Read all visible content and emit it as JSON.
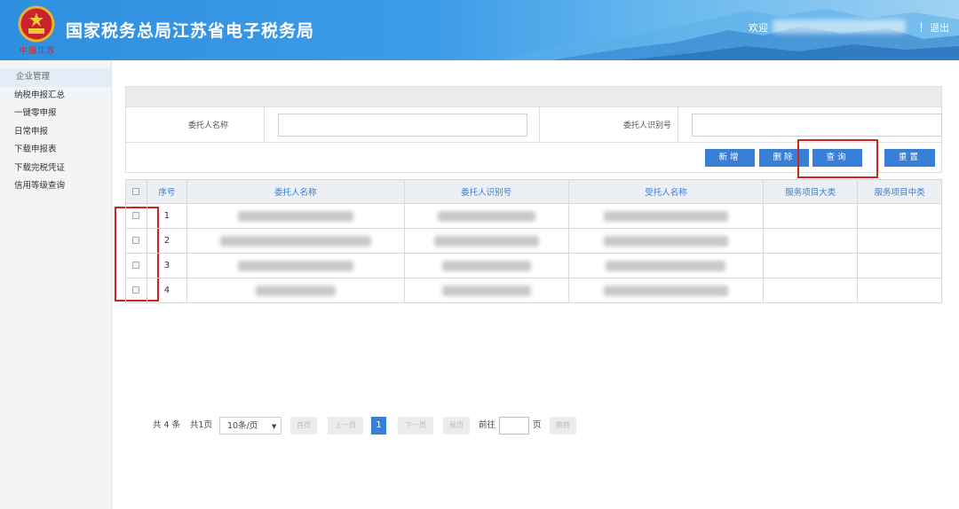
{
  "header": {
    "title": "国家税务总局江苏省电子税务局",
    "sub_logo": "中国江苏",
    "welcome": "欢迎",
    "logout": "退出"
  },
  "sidebar": {
    "items": [
      {
        "label": "企业管理"
      },
      {
        "label": "纳税申报汇总"
      },
      {
        "label": "一键零申报"
      },
      {
        "label": "日常申报"
      },
      {
        "label": "下载申报表"
      },
      {
        "label": "下载完税凭证"
      },
      {
        "label": "信用等级查询"
      }
    ]
  },
  "form": {
    "client_name_label": "委托人名称",
    "client_id_label": "委托人识别号",
    "client_name_value": "",
    "client_id_value": ""
  },
  "buttons": {
    "add": "新增",
    "delete": "删除",
    "query": "查询",
    "reset": "重置"
  },
  "table": {
    "columns": [
      "序号",
      "委托人名称",
      "委托人识别号",
      "受托人名称",
      "服务项目大类",
      "服务项目中类"
    ],
    "rows": [
      {
        "index": "1"
      },
      {
        "index": "2"
      },
      {
        "index": "3"
      },
      {
        "index": "4"
      }
    ]
  },
  "pagination": {
    "total": "共 4 条",
    "pages": "共1页",
    "page_size": "10条/页",
    "first": "首页",
    "prev": "上一页",
    "current": "1",
    "next": "下一页",
    "last": "尾页",
    "goto_label": "前往",
    "page_unit": "页",
    "jump": "跳转"
  },
  "colors": {
    "header_blue": "#2f8fe0",
    "button_blue": "#3a7fd6",
    "highlight_red": "#c6281f"
  }
}
